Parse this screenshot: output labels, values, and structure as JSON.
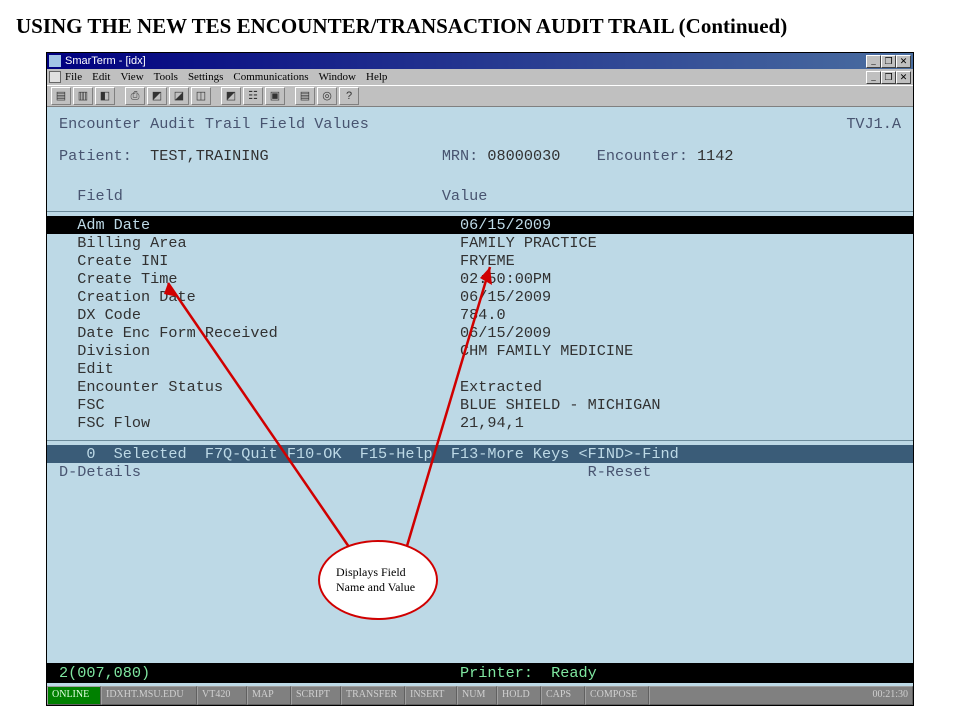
{
  "heading": "USING THE NEW TES ENCOUNTER/TRANSACTION AUDIT TRAIL (Continued)",
  "window": {
    "title": "SmarTerm - [idx]",
    "menu": [
      "File",
      "Edit",
      "View",
      "Tools",
      "Settings",
      "Communications",
      "Window",
      "Help"
    ],
    "min": "_",
    "max": "❐",
    "close": "✕"
  },
  "toolbar": [
    "▤",
    "▥",
    "◧",
    "⎙",
    "◩",
    "◪",
    "◫",
    "◩",
    "☷",
    "▣",
    "▤",
    "◎",
    "?"
  ],
  "term": {
    "screen_title": "Encounter Audit Trail Field Values",
    "screen_code": "TVJ1.A",
    "patient_label": "Patient:",
    "patient": "TEST,TRAINING",
    "mrn_label": "MRN:",
    "mrn": "08000030",
    "enc_label": "Encounter:",
    "enc": "1142",
    "col_field": "Field",
    "col_value": "Value",
    "rows": [
      {
        "f": "Adm Date",
        "v": "06/15/2009",
        "sel": true
      },
      {
        "f": "Billing Area",
        "v": "FAMILY PRACTICE"
      },
      {
        "f": "Create INI",
        "v": "FRYEME"
      },
      {
        "f": "Create Time",
        "v": "02:50:00PM"
      },
      {
        "f": "Creation Date",
        "v": "06/15/2009"
      },
      {
        "f": "DX Code",
        "v": "784.0"
      },
      {
        "f": "Date Enc Form Received",
        "v": "06/15/2009"
      },
      {
        "f": "Division",
        "v": "CHM FAMILY MEDICINE"
      },
      {
        "f": "Edit",
        "v": ""
      },
      {
        "f": "Encounter Status",
        "v": "Extracted"
      },
      {
        "f": "FSC",
        "v": "BLUE SHIELD - MICHIGAN"
      },
      {
        "f": "FSC Flow",
        "v": "21,94,1"
      }
    ],
    "fk_line": "   0  Selected  F7Q-Quit F10-OK  F15-Help  F13-More Keys <FIND>-Find",
    "details": "D-Details",
    "reset": "R-Reset",
    "cursor": "2(007,080)",
    "printer": "Printer:  Ready"
  },
  "status": {
    "segs": [
      "ONLINE",
      "IDXHT.MSU.EDU",
      "VT420",
      "MAP",
      "SCRIPT",
      "TRANSFER",
      "INSERT",
      "NUM",
      "HOLD",
      "CAPS",
      "COMPOSE",
      "00:21:30"
    ]
  },
  "callout": "Displays Field Name and Value"
}
